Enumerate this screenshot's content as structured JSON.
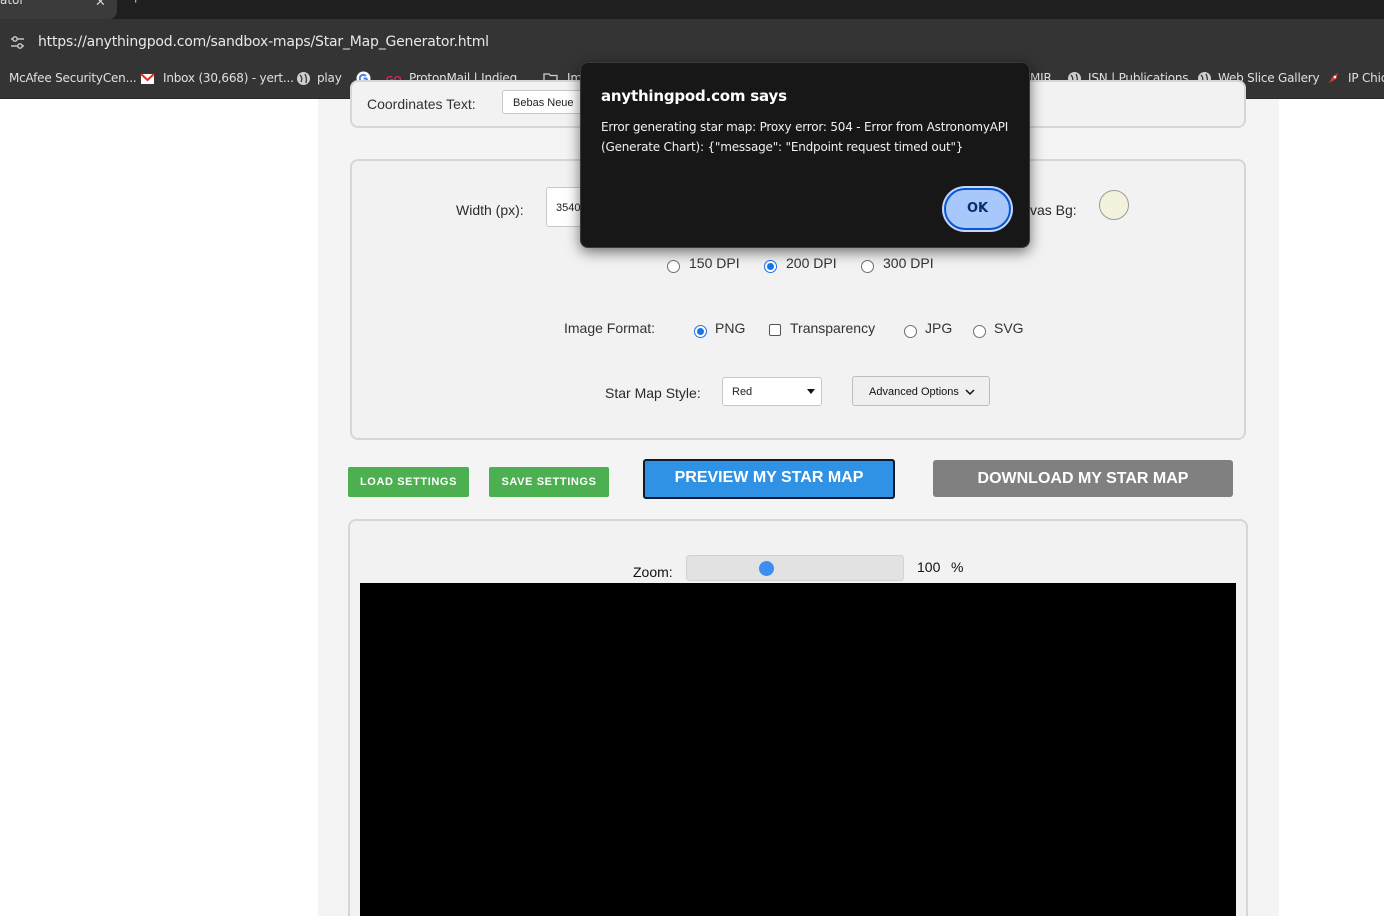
{
  "browser": {
    "tab_title": "ator",
    "tab_close": "✕",
    "new_tab": "+",
    "url": "https://anythingpod.com/sandbox-maps/Star_Map_Generator.html",
    "bookmarks": [
      {
        "label": "McAfee SecurityCen...",
        "icon": "mcafee-icon"
      },
      {
        "label": "Inbox (30,668) - yert...",
        "icon": "gmail-icon"
      },
      {
        "label": "play",
        "icon": "globe-icon"
      },
      {
        "label": "",
        "icon": "google-icon"
      },
      {
        "label": "ProtonMail | Indieg...",
        "icon": "go-icon"
      },
      {
        "label": "Im",
        "icon": "folder-icon"
      },
      {
        "label": "MIR",
        "icon": "globe-icon"
      },
      {
        "label": "ISN | Publications",
        "icon": "globe-icon"
      },
      {
        "label": "Web Slice Gallery",
        "icon": "globe-icon"
      },
      {
        "label": "IP Chic",
        "icon": "rocket-icon"
      }
    ]
  },
  "settings": {
    "coordinates_text_label": "Coordinates Text:",
    "coordinates_font_value": "Bebas Neue",
    "width_label": "Width (px):",
    "width_value": "3540",
    "canvas_bg_label": "vas Bg:",
    "canvas_bg_color": "#f3f2dd",
    "dpi_options": [
      {
        "label": "150 DPI",
        "selected": false
      },
      {
        "label": "200 DPI",
        "selected": true
      },
      {
        "label": "300 DPI",
        "selected": false
      }
    ],
    "image_format_label": "Image Format:",
    "formats": {
      "png": {
        "label": "PNG",
        "selected": true
      },
      "transparency": {
        "label": "Transparency",
        "checked": false
      },
      "jpg": {
        "label": "JPG",
        "selected": false
      },
      "svg": {
        "label": "SVG",
        "selected": false
      }
    },
    "style_label": "Star Map Style:",
    "style_value": "Red",
    "advanced_label": "Advanced Options"
  },
  "actions": {
    "load": "LOAD SETTINGS",
    "save": "SAVE SETTINGS",
    "preview": "PREVIEW MY STAR MAP",
    "download": "DOWNLOAD MY STAR MAP"
  },
  "preview": {
    "zoom_label": "Zoom:",
    "zoom_value": "100",
    "zoom_unit": "%",
    "zoom_fraction": 0.36,
    "canvas_color": "#000000"
  },
  "dialog": {
    "title": "anythingpod.com says",
    "message": "Error generating star map: Proxy error: 504  - Error from AstronomyAPI (Generate Chart): {\"message\": \"Endpoint request timed out\"}",
    "ok_label": "OK"
  },
  "colors": {
    "accent_green": "#4caf50",
    "accent_blue": "#2f92e5",
    "download_gray": "#808080",
    "dialog_bg": "#171717"
  }
}
